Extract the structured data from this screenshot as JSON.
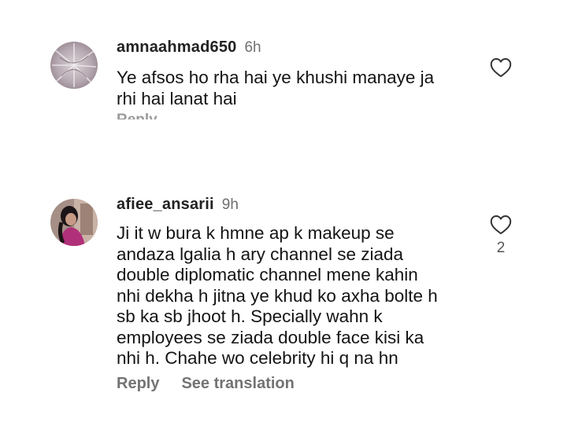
{
  "comments": [
    {
      "username": "amnaahmad650",
      "time": "6h",
      "lines": [
        "Ye afsos ho rha hai ye khushi manaye ja",
        "rhi hai lanat hai"
      ],
      "reply_label": "Reply",
      "icon": "heart-outline-icon"
    },
    {
      "username": "afiee_ansarii",
      "time": "9h",
      "lines": [
        "Ji it w bura k hmne ap k makeup se",
        "andaza lgalia h ary channel se ziada",
        "double diplomatic channel mene kahin",
        "nhi dekha h jitna ye khud ko axha bolte h",
        "sb ka sb jhoot h. Specially wahn k",
        "employees se ziada double face kisi ka",
        "nhi h. Chahe wo celebrity hi q na hn"
      ],
      "like_count": "2",
      "reply_label": "Reply",
      "translate_label": "See translation",
      "icon": "heart-outline-icon"
    }
  ]
}
